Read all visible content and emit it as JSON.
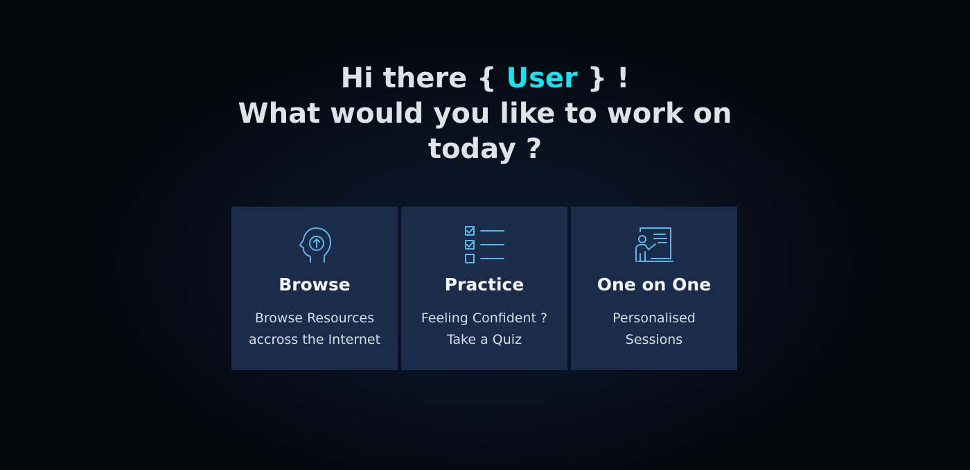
{
  "headline": {
    "greeting_prefix": "Hi there { ",
    "user": "User",
    "greeting_suffix": " } !",
    "line2": "What would you like to work on",
    "line3": "today ?"
  },
  "colors": {
    "background": "#070d18",
    "card": "#1b2c4a",
    "accent_user": "#14e4ef",
    "icon_stroke": "#5db8e8"
  },
  "cards": [
    {
      "icon": "head-arrow-up-icon",
      "title": "Browse",
      "desc_line1": "Browse Resources",
      "desc_line2": "accross the Internet"
    },
    {
      "icon": "checklist-icon",
      "title": "Practice",
      "desc_line1": "Feeling Confident ?",
      "desc_line2": "Take a Quiz"
    },
    {
      "icon": "presenter-board-icon",
      "title": "One on One",
      "desc_line1": "Personalised",
      "desc_line2": "Sessions"
    }
  ]
}
